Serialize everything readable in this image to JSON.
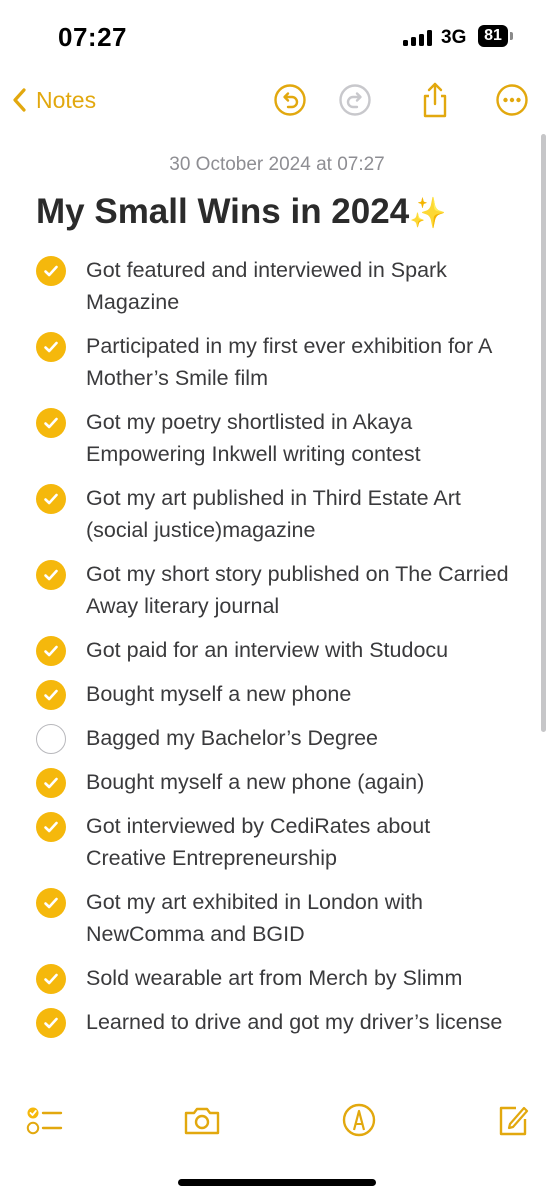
{
  "status_bar": {
    "time": "07:27",
    "network": "3G",
    "battery": "81"
  },
  "nav": {
    "back_label": "Notes",
    "icons": [
      "undo-icon",
      "redo-icon",
      "share-icon",
      "more-icon"
    ]
  },
  "note": {
    "date": "30 October 2024 at 07:27",
    "title": "My Small Wins in 2024",
    "title_emoji": "✨"
  },
  "checklist": [
    {
      "text": "Got featured and interviewed in Spark Magazine",
      "checked": true
    },
    {
      "text": "Participated in my first ever exhibition for A Mother’s Smile film",
      "checked": true
    },
    {
      "text": "Got my poetry shortlisted in Akaya Empowering Inkwell writing contest",
      "checked": true
    },
    {
      "text": "Got my art published in Third Estate Art (social justice)magazine",
      "checked": true
    },
    {
      "text": "Got my short story published on The Carried Away literary journal",
      "checked": true
    },
    {
      "text": "Got paid for an interview with Studocu",
      "checked": true
    },
    {
      "text": "Bought myself a new phone",
      "checked": true
    },
    {
      "text": "Bagged my Bachelor’s Degree",
      "checked": false
    },
    {
      "text": "Bought myself a new phone (again)",
      "checked": true
    },
    {
      "text": "Got interviewed by CediRates about Creative Entrepreneurship",
      "checked": true
    },
    {
      "text": "Got my art exhibited in London with NewComma and BGID",
      "checked": true
    },
    {
      "text": "Sold wearable art from Merch by Slimm",
      "checked": true
    },
    {
      "text": "Learned to drive and got my driver’s license",
      "checked": true
    }
  ],
  "toolbar": {
    "icons": [
      "checklist-icon",
      "camera-icon",
      "markup-icon",
      "compose-icon"
    ]
  },
  "colors": {
    "accent": "#f5b80c",
    "accent_text": "#e2a80e",
    "text": "#3a3a3c",
    "secondary": "#8e8e93"
  }
}
